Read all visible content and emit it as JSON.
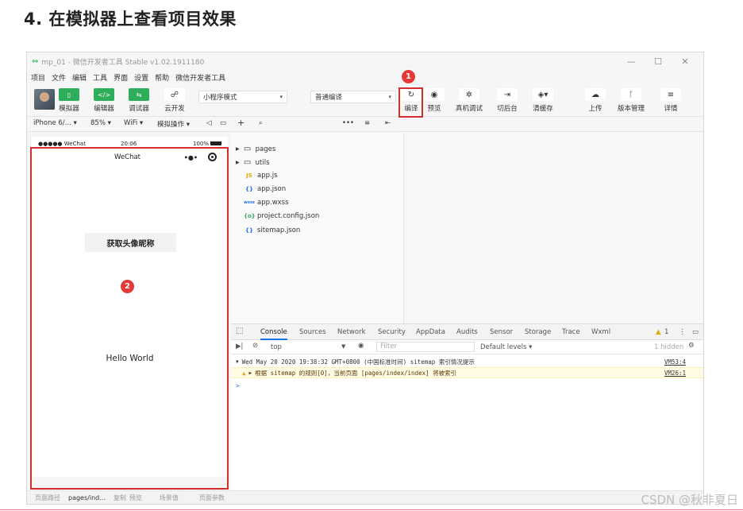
{
  "slide": {
    "heading": "4. 在模拟器上查看项目效果",
    "watermark": "CSDN @秋非夏日"
  },
  "window": {
    "title": "mp_01 - 微信开发者工具 Stable v1.02.1911180",
    "minimize": "—",
    "maximize": "☐",
    "close": "✕"
  },
  "menu": [
    "项目",
    "文件",
    "编辑",
    "工具",
    "界面",
    "设置",
    "帮助",
    "微信开发者工具"
  ],
  "toolbar": {
    "simulator_label": "模拟器",
    "editor_label": "编辑器",
    "debugger_label": "调试器",
    "cloud_label": "云开发",
    "mode_select": "小程序模式",
    "compile_select": "普通编译",
    "compile_label": "编译",
    "preview_label": "预览",
    "remote_debug_label": "真机调试",
    "background_label": "切后台",
    "clear_cache_label": "清缓存",
    "upload_label": "上传",
    "version_label": "版本管理",
    "details_label": "详情"
  },
  "subbar": {
    "device": "iPhone 6/...",
    "zoom": "85%",
    "network": "WiFi",
    "simulate_op": "模拟操作"
  },
  "annotations": {
    "badge1": "1",
    "badge2": "2"
  },
  "phone": {
    "carrier": "●●●●● WeChat",
    "time": "20:06",
    "battery": "100%",
    "nav_title": "WeChat",
    "capsule_dots": "•●•",
    "button_text": "获取头像昵称",
    "hello": "Hello World"
  },
  "explorer": {
    "items": [
      {
        "icon": "folder",
        "name": "pages"
      },
      {
        "icon": "folder",
        "name": "utils"
      },
      {
        "icon": "JS",
        "name": "app.js"
      },
      {
        "icon": "{}",
        "name": "app.json"
      },
      {
        "icon": "wxss",
        "name": "app.wxss"
      },
      {
        "icon": "{o}",
        "name": "project.config.json"
      },
      {
        "icon": "{}",
        "name": "sitemap.json"
      }
    ]
  },
  "devtools": {
    "tabs": [
      "Console",
      "Sources",
      "Network",
      "Security",
      "AppData",
      "Audits",
      "Sensor",
      "Storage",
      "Trace",
      "Wxml"
    ],
    "warning_count": "1",
    "context": "top",
    "filter_placeholder": "Filter",
    "levels": "Default levels ▾",
    "hidden": "1 hidden",
    "log_line": "Wed May 20 2020 19:38:32 GMT+0800 (中国标准时间) sitemap 索引情况提示",
    "log_link": "VM53:4",
    "warn_line": "根据 sitemap 的规则[0]，当前页面 [pages/index/index] 将被索引",
    "warn_link": "VM26:1",
    "prompt": ">"
  },
  "statusbar": {
    "path_label": "页面路径",
    "path_value": "pages/ind...",
    "copy": "复制",
    "preview": "预览",
    "scene": "场景值",
    "params": "页面参数"
  },
  "colors": {
    "green": "#2eae5a",
    "highlight_red": "#d32f2f",
    "badge_red": "#e53935"
  }
}
